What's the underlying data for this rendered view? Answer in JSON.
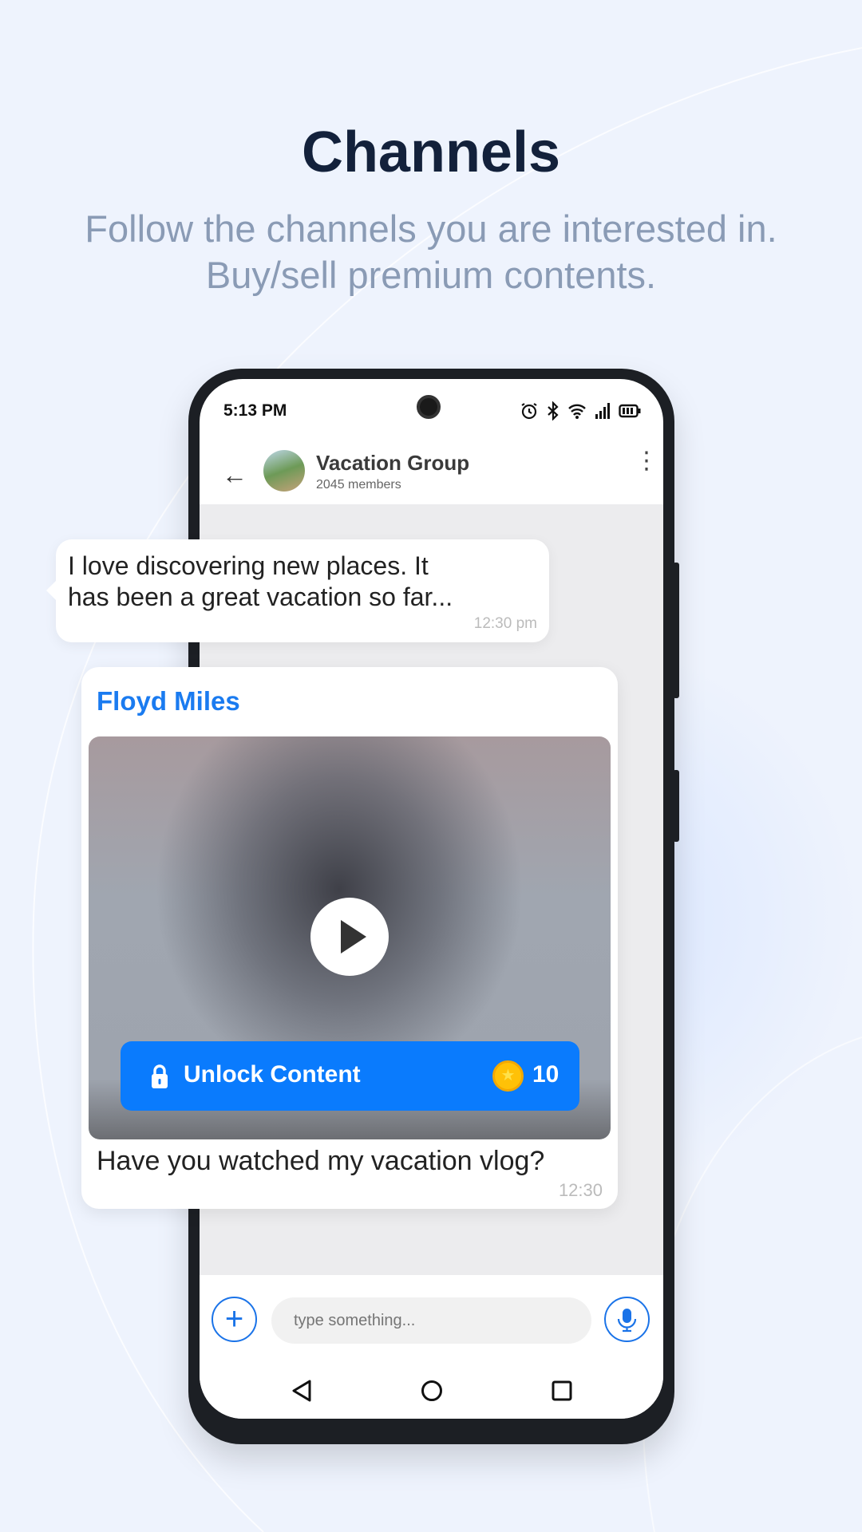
{
  "hero": {
    "title": "Channels",
    "subtitle_line1": "Follow the channels you are interested in.",
    "subtitle_line2": "Buy/sell premium contents."
  },
  "status_bar": {
    "time": "5:13 PM",
    "icons": [
      "alarm-icon",
      "bluetooth-icon",
      "wifi-icon",
      "signal-icon",
      "battery-icon"
    ]
  },
  "chat_header": {
    "name": "Vacation Group",
    "members": "2045 members"
  },
  "messages": [
    {
      "text_line1": "I love discovering new places. It",
      "text_line2": "has been a great vacation so far...",
      "time": "12:30 pm"
    },
    {
      "sender": "Floyd Miles",
      "unlock_label": "Unlock Content",
      "price": "10",
      "text": "Have you watched my vacation vlog?",
      "time": "12:30"
    }
  ],
  "input": {
    "placeholder": "type something..."
  },
  "colors": {
    "accent": "#0a7bfd",
    "sender": "#1a7bf0",
    "title": "#13213b",
    "subtitle": "#8a9bb5",
    "coin": "#ffc107"
  }
}
